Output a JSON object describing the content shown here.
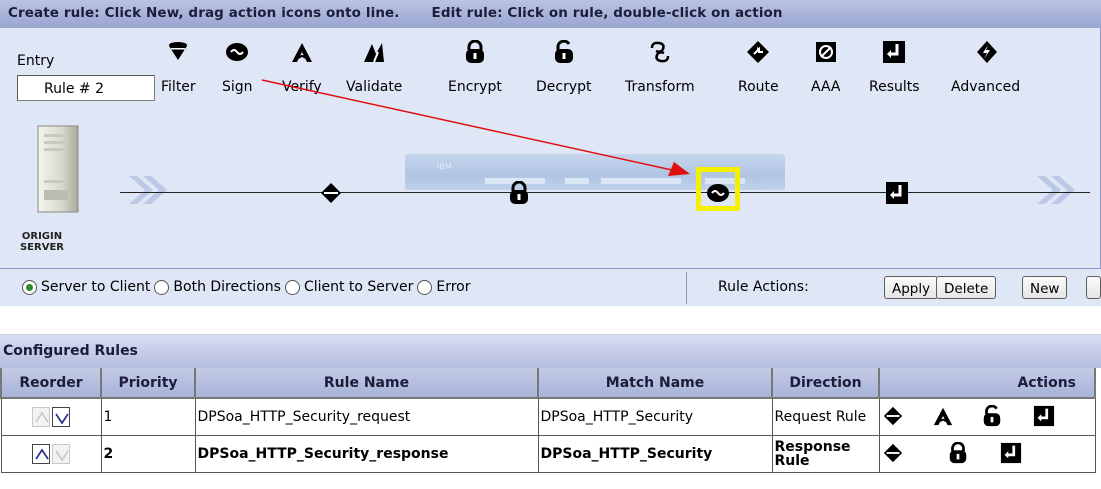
{
  "instructions": {
    "create": "Create rule: Click New, drag action icons onto line.",
    "edit": "Edit rule: Click on rule, double-click on action"
  },
  "entry": {
    "label": "Entry",
    "rule_name": "Rule # 2"
  },
  "tools": [
    {
      "label": "Filter",
      "icon": "filter-icon"
    },
    {
      "label": "Sign",
      "icon": "sign-icon"
    },
    {
      "label": "Verify",
      "icon": "verify-icon"
    },
    {
      "label": "Validate",
      "icon": "validate-icon"
    },
    {
      "label": "Encrypt",
      "icon": "encrypt-lock-icon"
    },
    {
      "label": "Decrypt",
      "icon": "decrypt-unlock-icon"
    },
    {
      "label": "Transform",
      "icon": "transform-icon"
    },
    {
      "label": "Route",
      "icon": "route-icon"
    },
    {
      "label": "AAA",
      "icon": "aaa-icon"
    },
    {
      "label": "Results",
      "icon": "results-icon"
    },
    {
      "label": "Advanced",
      "icon": "advanced-icon"
    }
  ],
  "canvas": {
    "server_label_line1": "ORIGIN",
    "server_label_line2": "SERVER",
    "device_brand": "IBM",
    "rule_actions": [
      "match-icon",
      "encrypt-lock-icon",
      "sign-icon",
      "results-icon"
    ],
    "selected_action": "sign-icon",
    "annotation_arrow_color": "#e01010",
    "selection_color": "#f5f000"
  },
  "direction": {
    "options": [
      "Server to Client",
      "Both Directions",
      "Client to Server",
      "Error"
    ],
    "selected": "Server to Client"
  },
  "rule_actions": {
    "label": "Rule Actions:",
    "buttons": [
      "Apply",
      "Delete",
      "New"
    ]
  },
  "configured_rules": {
    "title": "Configured Rules",
    "columns": [
      "Reorder",
      "Priority",
      "Rule Name",
      "Match Name",
      "Direction",
      "Actions"
    ],
    "rows": [
      {
        "priority": "1",
        "rule_name": "DPSoa_HTTP_Security_request",
        "match_name": "DPSoa_HTTP_Security",
        "direction": "Request Rule",
        "actions": [
          "match-icon",
          "verify-icon",
          "decrypt-unlock-icon",
          "results-icon"
        ],
        "up_enabled": false,
        "down_enabled": true,
        "bold": false
      },
      {
        "priority": "2",
        "rule_name": "DPSoa_HTTP_Security_response",
        "match_name": "DPSoa_HTTP_Security",
        "direction": "Response Rule",
        "actions": [
          "match-icon",
          "encrypt-lock-icon",
          "results-icon"
        ],
        "up_enabled": true,
        "down_enabled": false,
        "bold": true
      }
    ]
  }
}
